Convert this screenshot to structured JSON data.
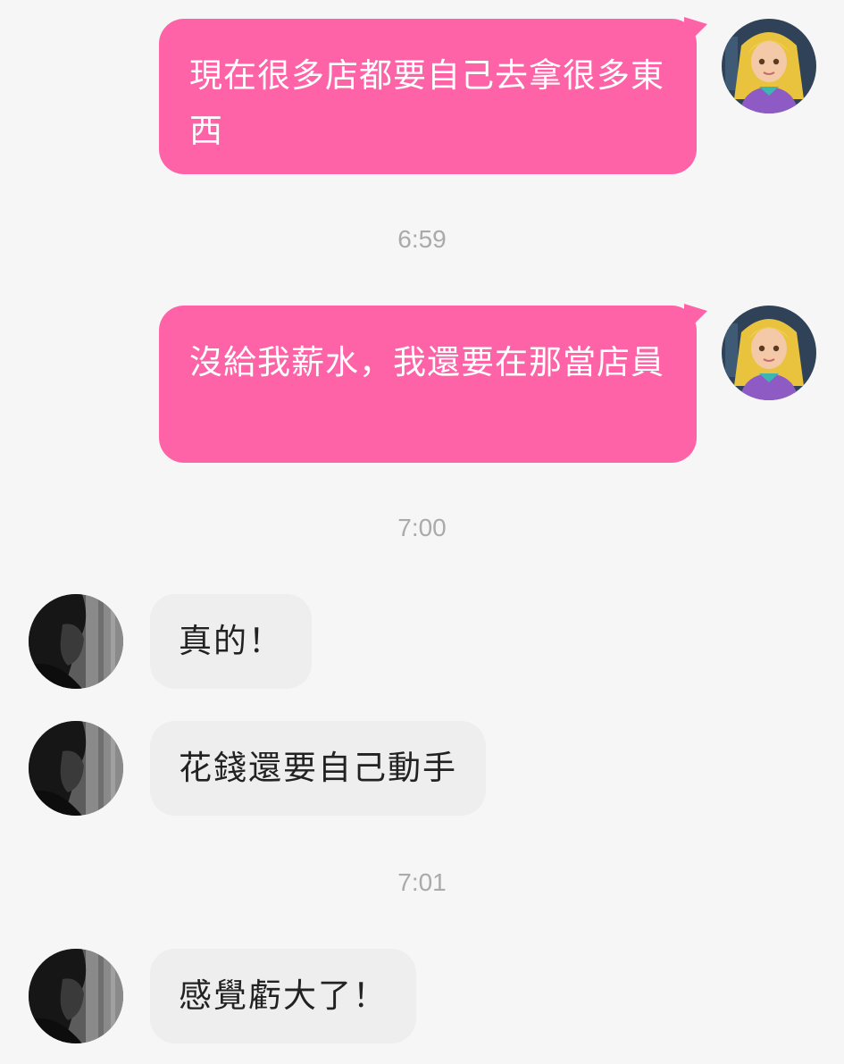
{
  "messages": [
    {
      "side": "out",
      "text": "現在很多店都要自己去拿很多東西",
      "avatar": "girl-avatar"
    },
    {
      "side": "timestamp",
      "text": "6:59"
    },
    {
      "side": "out",
      "text": "沒給我薪水，我還要在那當店員",
      "avatar": "girl-avatar"
    },
    {
      "side": "timestamp",
      "text": "7:00"
    },
    {
      "side": "in",
      "text": "真的！",
      "avatar": "man-avatar"
    },
    {
      "side": "in",
      "text": "花錢還要自己動手",
      "avatar": "man-avatar"
    },
    {
      "side": "timestamp",
      "text": "7:01"
    },
    {
      "side": "in",
      "text": "感覺虧大了！",
      "avatar": "man-avatar"
    }
  ],
  "colors": {
    "background": "#f6f6f6",
    "outgoing_bubble": "#ff63a7",
    "incoming_bubble": "#eeeeee",
    "timestamp_text": "#aaaaaa"
  }
}
